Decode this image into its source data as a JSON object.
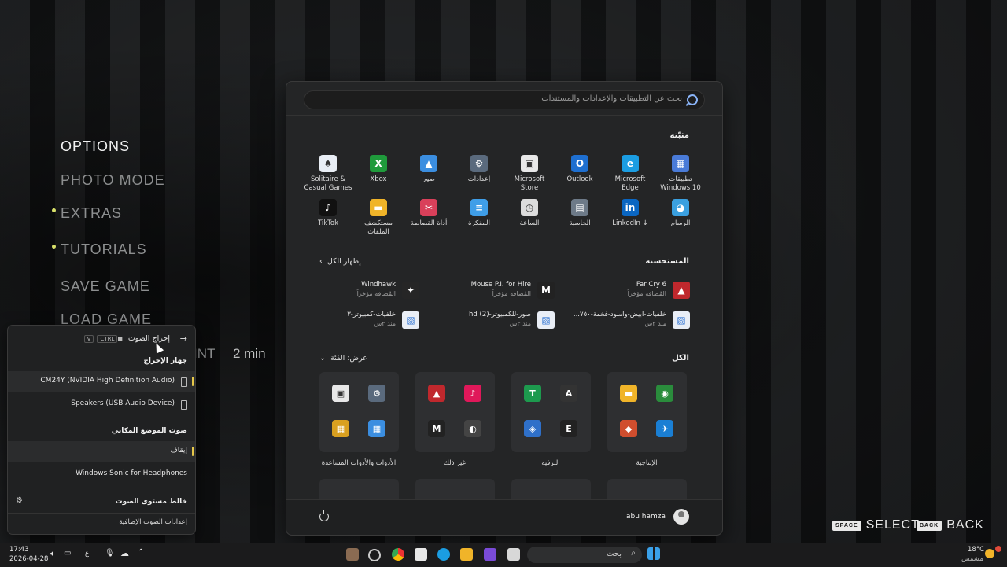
{
  "game_menu": {
    "items": [
      {
        "label": "OPTIONS",
        "active": true,
        "dot": false
      },
      {
        "label": "PHOTO MODE",
        "active": false,
        "dot": false
      },
      {
        "label": "EXTRAS",
        "active": false,
        "dot": true
      },
      {
        "label": "TUTORIALS",
        "active": false,
        "dot": true
      },
      {
        "label": "SAVE GAME",
        "active": false,
        "dot": false
      },
      {
        "label": "LOAD GAME",
        "active": false,
        "dot": false
      }
    ],
    "partial_text": "INT",
    "time_label": "2 min",
    "hints": [
      {
        "key": "SPACE",
        "label": "SELECT"
      },
      {
        "key": "BACK",
        "label": "BACK"
      }
    ],
    "dot_color": "#d8e06a"
  },
  "start_menu": {
    "search_placeholder": "بحث عن التطبيقات والإعدادات والمستندات",
    "pinned_title": "مثبّتة",
    "pinned": [
      {
        "label": "تطبيقات Windows 10",
        "icon": "apps-icon",
        "color": "#4a7bd8",
        "glyph": "▦"
      },
      {
        "label": "Microsoft Edge",
        "icon": "edge-icon",
        "color": "#1b9de2",
        "glyph": "e"
      },
      {
        "label": "Outlook",
        "icon": "outlook-icon",
        "color": "#1e6fd0",
        "glyph": "O"
      },
      {
        "label": "Microsoft Store",
        "icon": "store-icon",
        "color": "#e8e8e8",
        "glyph": "▣"
      },
      {
        "label": "إعدادات",
        "icon": "settings-icon",
        "color": "#5a6a7d",
        "glyph": "⚙"
      },
      {
        "label": "صور",
        "icon": "photos-icon",
        "color": "#3b8ee0",
        "glyph": "▲"
      },
      {
        "label": "Xbox",
        "icon": "xbox-icon",
        "color": "#1f9a3b",
        "glyph": "X"
      },
      {
        "label": "Solitaire & Casual Games",
        "icon": "solitaire-icon",
        "color": "#e9eef5",
        "glyph": "♠"
      },
      {
        "label": "الرسام",
        "icon": "paint-icon",
        "color": "#3aa0e0",
        "glyph": "◕"
      },
      {
        "label": "LinkedIn ↓",
        "icon": "linkedin-icon",
        "color": "#0a66c2",
        "glyph": "in"
      },
      {
        "label": "الحاسبة",
        "icon": "calculator-icon",
        "color": "#6d7a88",
        "glyph": "▤"
      },
      {
        "label": "الساعة",
        "icon": "clock-icon",
        "color": "#dcdcdc",
        "glyph": "◷"
      },
      {
        "label": "المفكرة",
        "icon": "notepad-icon",
        "color": "#3f9ee8",
        "glyph": "≡"
      },
      {
        "label": "أداة القصاصة",
        "icon": "snipping-tool-icon",
        "color": "#d9405a",
        "glyph": "✂"
      },
      {
        "label": "مستكشف الملفات",
        "icon": "file-explorer-icon",
        "color": "#f0b429",
        "glyph": "▬"
      },
      {
        "label": "TikTok",
        "icon": "tiktok-icon",
        "color": "#111111",
        "glyph": "♪"
      }
    ],
    "recommended_title": "المستحسنة",
    "show_all": "إظهار الكل",
    "recommended": [
      {
        "title": "Far Cry 6",
        "sub": "المُضافة مؤخراً",
        "icon": "farcry-icon",
        "color": "#c0282d",
        "glyph": "▲"
      },
      {
        "title": "Mouse P.I. for Hire",
        "sub": "المُضافة مؤخراً",
        "icon": "mouse-pi-icon",
        "color": "#222222",
        "glyph": "M"
      },
      {
        "title": "Windhawk",
        "sub": "المُضافة مؤخراً",
        "icon": "windhawk-icon",
        "color": "#262626",
        "glyph": "✦"
      },
      {
        "title": "خلفيات-ابيض-واسود-فخمة-٧٥٠...",
        "sub": "منذ ٣س",
        "icon": "image-file-icon",
        "color": "#e9eef6",
        "glyph": "▧"
      },
      {
        "title": "صور-للكمبيوتر-hd (2)",
        "sub": "منذ ٣س",
        "icon": "image-file-icon",
        "color": "#e9eef6",
        "glyph": "▧"
      },
      {
        "title": "خلفيات-كمبيوتر-٣",
        "sub": "منذ ٣س",
        "icon": "image-file-icon",
        "color": "#e9eef6",
        "glyph": "▧"
      }
    ],
    "all_title": "الكل",
    "view_label": "عرض: الفئة",
    "folders": [
      {
        "label": "الإنتاجية",
        "icons": [
          {
            "c": "#2a8c3c",
            "g": "◉",
            "n": "chrome-icon"
          },
          {
            "c": "#f0b429",
            "g": "▬",
            "n": "file-explorer-icon"
          },
          {
            "c": "#1a7fd4",
            "g": "✈",
            "n": "app-icon"
          },
          {
            "c": "#d04e2e",
            "g": "◆",
            "n": "office-icon"
          }
        ]
      },
      {
        "label": "الترفيه",
        "icons": [
          {
            "c": "#333333",
            "g": "A",
            "n": "game-icon"
          },
          {
            "c": "#1d9a4e",
            "g": "T",
            "n": "tool-icon"
          },
          {
            "c": "#222222",
            "g": "E",
            "n": "epic-games-icon"
          },
          {
            "c": "#2f70c9",
            "g": "◈",
            "n": "game-icon"
          }
        ]
      },
      {
        "label": "غير ذلك",
        "icons": [
          {
            "c": "#e0185a",
            "g": "♪",
            "n": "tiktok-icon"
          },
          {
            "c": "#c0282d",
            "g": "▲",
            "n": "farcry-icon"
          },
          {
            "c": "#444444",
            "g": "◐",
            "n": "app-icon"
          },
          {
            "c": "#222222",
            "g": "M",
            "n": "mouse-pi-icon"
          }
        ]
      },
      {
        "label": "الأدوات والأدوات المساعدة",
        "icons": [
          {
            "c": "#5a6a7d",
            "g": "⚙",
            "n": "settings-icon"
          },
          {
            "c": "#e8e8e8",
            "g": "▣",
            "n": "store-icon"
          },
          {
            "c": "#3b8ee0",
            "g": "▦",
            "n": "app-icon"
          },
          {
            "c": "#d9a020",
            "g": "▦",
            "n": "app-icon"
          }
        ]
      }
    ],
    "user_name": "abu hamza"
  },
  "audio_flyout": {
    "title": "إخراج الصوت",
    "shortcut_keys": [
      "CTRL",
      "V"
    ],
    "device_header": "جهاز الإخراج",
    "devices": [
      {
        "label": "CM24Y (NVIDIA High Definition Audio)",
        "selected": true
      },
      {
        "label": "Speakers (USB Audio Device)",
        "selected": false
      }
    ],
    "spatial_header": "صوت الموضع المكاني",
    "spatial_options": [
      {
        "label": "إيقاف",
        "selected": true
      },
      {
        "label": "Windows Sonic for Headphones",
        "selected": false
      }
    ],
    "mixer_header": "خالط مستوى الصوت",
    "more_settings": "إعدادات الصوت الإضافية",
    "accent": "#e6c84a"
  },
  "taskbar": {
    "time": "17:43",
    "date": "2026-04-28",
    "lang": "ع",
    "search_placeholder": "بحث",
    "weather_temp": "18°C",
    "weather_desc": "مشمس"
  }
}
